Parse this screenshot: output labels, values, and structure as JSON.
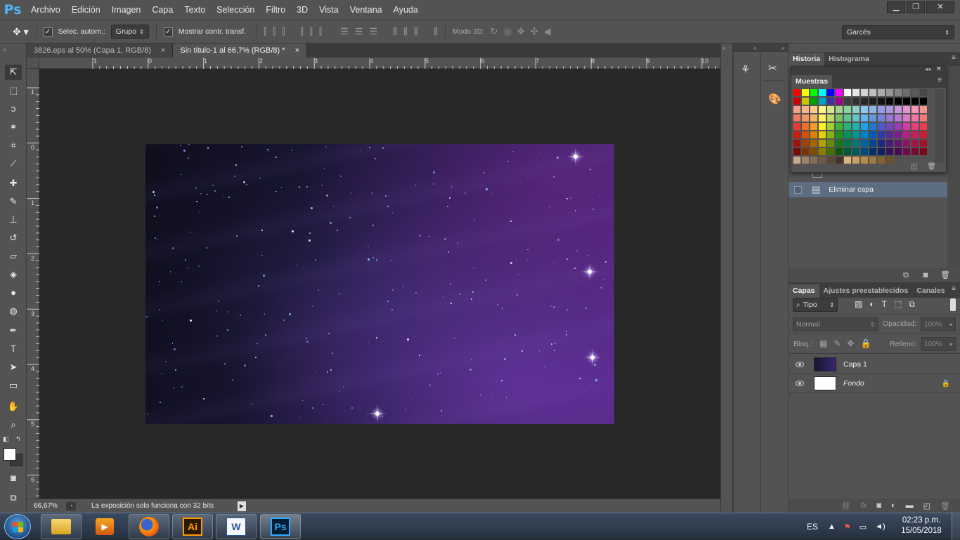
{
  "app": {
    "logo": "Ps",
    "menu": [
      "Archivo",
      "Edición",
      "Imagen",
      "Capa",
      "Texto",
      "Selección",
      "Filtro",
      "3D",
      "Vista",
      "Ventana",
      "Ayuda"
    ],
    "window_controls": [
      "minimize",
      "restore",
      "close"
    ]
  },
  "options": {
    "auto_select_label": "Selec. autom.:",
    "auto_select_value": "Grupo",
    "show_transform_label": "Mostrar contr. transf.",
    "mode3d_label": "Modo 3D:",
    "workspace_value": "Garcés"
  },
  "tabs": [
    {
      "label": "3826.eps al 50% (Capa 1, RGB/8)",
      "close": "×"
    },
    {
      "label": "Sin título-1 al 66,7% (RGB/8) *",
      "close": "×"
    }
  ],
  "ruler_top": [
    "1",
    "0",
    "1",
    "2",
    "3",
    "4",
    "5",
    "6",
    "7",
    "8",
    "9",
    "10"
  ],
  "ruler_left": [
    "1",
    "0",
    "1",
    "2",
    "3",
    "4",
    "5",
    "6"
  ],
  "status": {
    "zoom": "66,67%",
    "message": "La exposición solo funciona con 32 bits"
  },
  "history": {
    "tabs": [
      "Historia",
      "Histograma"
    ],
    "last_item": "Eliminar capa"
  },
  "swatches": {
    "title": "Muestras",
    "rows": [
      [
        "#ff0000",
        "#ffff00",
        "#00ff00",
        "#00ffff",
        "#0000ff",
        "#ff00ff",
        "#ffffff",
        "#e6e6e6",
        "#d2d2d2",
        "#bebebe",
        "#aaaaaa",
        "#969696",
        "#828282",
        "#6e6e6e",
        "#5a5a5a",
        "#464646"
      ],
      [
        "#c80000",
        "#c8c800",
        "#00a000",
        "#00a0c8",
        "#3c32a0",
        "#a0008c",
        "#3c3c3c",
        "#323232",
        "#282828",
        "#1e1e1e",
        "#141414",
        "#0a0a0a",
        "#000000",
        "#000000",
        "#000000",
        "#000000"
      ],
      [
        "#f5a08c",
        "#f5b48c",
        "#f8cd8c",
        "#fff58c",
        "#d2e68c",
        "#a0d28c",
        "#8cd2a0",
        "#8cd2c8",
        "#8cc8f0",
        "#8cb4e6",
        "#969be6",
        "#aa96dc",
        "#c896dc",
        "#e696d2",
        "#f596b4",
        "#f5968c"
      ],
      [
        "#f07864",
        "#f59664",
        "#f8b464",
        "#fff064",
        "#bedc64",
        "#78c364",
        "#64c38c",
        "#64c3c3",
        "#64b4eb",
        "#6496dc",
        "#7882d7",
        "#9678d2",
        "#b478cd",
        "#e178c3",
        "#f078a0",
        "#f07878"
      ],
      [
        "#eb3c32",
        "#f06e28",
        "#f59b28",
        "#fff01e",
        "#a0d232",
        "#3cb43c",
        "#28b478",
        "#1eb4b4",
        "#1ea0e6",
        "#1e78d2",
        "#4b5ac8",
        "#7346be",
        "#9b3cb4",
        "#d23ca0",
        "#eb3c78",
        "#eb3c50"
      ],
      [
        "#c81e14",
        "#d2500a",
        "#dc8200",
        "#e6d200",
        "#82b414",
        "#1e961e",
        "#00965a",
        "#009696",
        "#0082c8",
        "#005ab4",
        "#2d3ca5",
        "#5a2896",
        "#7d1e8c",
        "#b41e82",
        "#c81e5a",
        "#c81e32"
      ],
      [
        "#a0140a",
        "#a04100",
        "#aa6400",
        "#b4a000",
        "#648c0a",
        "#147814",
        "#007846",
        "#007878",
        "#00649b",
        "#004691",
        "#1e2882",
        "#461e73",
        "#641473",
        "#8c145f",
        "#a01446",
        "#a01428"
      ],
      [
        "#780a00",
        "#7d3200",
        "#824b00",
        "#8c7d00",
        "#466e00",
        "#0a5a0a",
        "#005a32",
        "#005a5a",
        "#004b78",
        "#003269",
        "#141e5f",
        "#321455",
        "#4b0a55",
        "#6e0a46",
        "#780a32",
        "#780a1e"
      ],
      [
        "#c8aa8c",
        "#a08264",
        "#826e5a",
        "#6e5a46",
        "#5a4632",
        "#463228",
        "#dcb482",
        "#c8a064",
        "#b48c50",
        "#a07841",
        "#826432",
        "#6e5028"
      ]
    ]
  },
  "layers": {
    "tabs": [
      "Capas",
      "Ajustes preestablecidos",
      "Canales"
    ],
    "filter_label": "Tipo",
    "blend_mode": "Normal",
    "opacity_label": "Opacidad:",
    "opacity_value": "100%",
    "lock_label": "Bloq.:",
    "fill_label": "Relleno:",
    "fill_value": "100%",
    "items": [
      {
        "name": "Capa 1",
        "visible": true
      },
      {
        "name": "Fondo",
        "visible": true,
        "locked": true
      }
    ]
  },
  "taskbar": {
    "apps": [
      "explorer",
      "media-player",
      "firefox",
      "illustrator",
      "word",
      "photoshop"
    ],
    "ai_label": "Ai",
    "ps_label": "Ps",
    "word_label": "W",
    "lang": "ES",
    "time": "02:23 p.m.",
    "date": "15/05/2018"
  },
  "colors": {
    "panel": "#535353",
    "canvas_bg": "#282828",
    "ps_blue": "#4fb4f7",
    "accent_purple": "#4a2479"
  }
}
